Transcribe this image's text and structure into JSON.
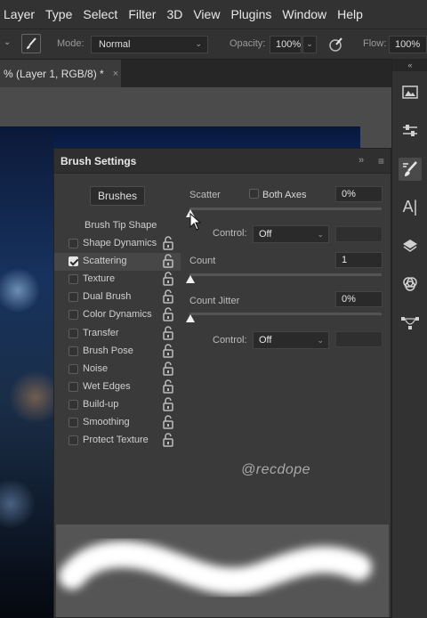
{
  "menubar": {
    "items": [
      "Layer",
      "Type",
      "Select",
      "Filter",
      "3D",
      "View",
      "Plugins",
      "Window",
      "Help"
    ]
  },
  "options_bar": {
    "mode_label": "Mode:",
    "mode_value": "Normal",
    "opacity_label": "Opacity:",
    "opacity_value": "100%",
    "flow_label": "Flow:",
    "flow_value": "100%"
  },
  "document_tab": {
    "title": "% (Layer 1, RGB/8) *",
    "close": "×"
  },
  "brush_panel": {
    "title": "Brush Settings",
    "collapse_glyph": "»",
    "menu_glyph": "≡",
    "brushes_button": "Brushes",
    "brush_tip_shape": "Brush Tip Shape",
    "options": [
      {
        "label": "Shape Dynamics",
        "checked": false,
        "selected": false
      },
      {
        "label": "Scattering",
        "checked": true,
        "selected": true
      },
      {
        "label": "Texture",
        "checked": false,
        "selected": false
      },
      {
        "label": "Dual Brush",
        "checked": false,
        "selected": false
      },
      {
        "label": "Color Dynamics",
        "checked": false,
        "selected": false
      },
      {
        "label": "Transfer",
        "checked": false,
        "selected": false
      },
      {
        "label": "Brush Pose",
        "checked": false,
        "selected": false
      },
      {
        "label": "Noise",
        "checked": false,
        "selected": false
      },
      {
        "label": "Wet Edges",
        "checked": false,
        "selected": false
      },
      {
        "label": "Build-up",
        "checked": false,
        "selected": false
      },
      {
        "label": "Smoothing",
        "checked": false,
        "selected": false
      },
      {
        "label": "Protect Texture",
        "checked": false,
        "selected": false
      }
    ],
    "scattering": {
      "scatter_label": "Scatter",
      "both_axes_label": "Both Axes",
      "both_axes_checked": false,
      "scatter_value": "0%",
      "scatter_level": 0,
      "control1_label": "Control:",
      "control1_value": "Off",
      "count_label": "Count",
      "count_value": "1",
      "count_level": 0,
      "count_jitter_label": "Count Jitter",
      "count_jitter_value": "0%",
      "count_jitter_level": 0,
      "control2_label": "Control:",
      "control2_value": "Off"
    },
    "watermark": "@recdope"
  },
  "colors": {
    "panel_bg": "#3a3a3a",
    "chrome_bg": "#323232",
    "text": "#cfcfcf",
    "preview_bg": "#555555"
  }
}
